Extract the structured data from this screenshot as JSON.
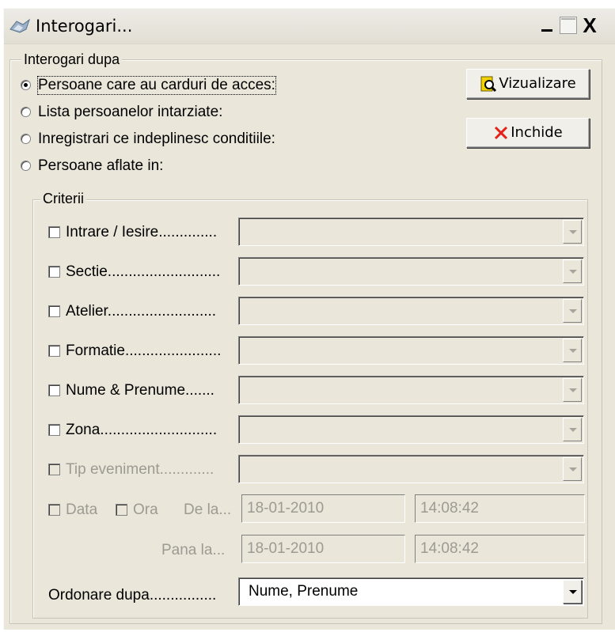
{
  "window": {
    "title": "Interogari...",
    "controls": {
      "minimize": "_",
      "close": "X"
    }
  },
  "query_group": {
    "legend": "Interogari dupa",
    "options": [
      {
        "label": "Persoane care au carduri de acces:",
        "selected": true
      },
      {
        "label": "Lista persoanelor intarziate:",
        "selected": false
      },
      {
        "label": "Inregistrari ce indeplinesc conditiile:",
        "selected": false
      },
      {
        "label": "Persoane aflate in:",
        "selected": false
      }
    ]
  },
  "buttons": {
    "view": "Vizualizare",
    "close": "Inchide",
    "view_icon": "preview-icon",
    "close_icon": "close-icon"
  },
  "criteria": {
    "legend": "Criterii",
    "fields": [
      {
        "label": "Intrare / Iesire..............",
        "checked": false,
        "enabled": true
      },
      {
        "label": "Sectie...........................",
        "checked": false,
        "enabled": true
      },
      {
        "label": "Atelier..........................",
        "checked": false,
        "enabled": true
      },
      {
        "label": "Formatie.......................",
        "checked": false,
        "enabled": true
      },
      {
        "label": "Nume & Prenume.......",
        "checked": false,
        "enabled": true
      },
      {
        "label": "Zona............................",
        "checked": false,
        "enabled": true
      },
      {
        "label": "Tip eveniment.............",
        "checked": false,
        "enabled": false
      }
    ],
    "date_label": "Data",
    "time_label": "Ora",
    "from_label": "De la...",
    "to_label": "Pana la...",
    "from_date": "18-01-2010",
    "from_time": "14:08:42",
    "to_date": "18-01-2010",
    "to_time": "14:08:42",
    "order_label": "Ordonare dupa................",
    "order_value": "Nume, Prenume"
  },
  "colors": {
    "face": "#eae6da",
    "disabled_text": "#9c9a92",
    "close_x": "#e0241b",
    "preview_icon": "#f2d200"
  }
}
